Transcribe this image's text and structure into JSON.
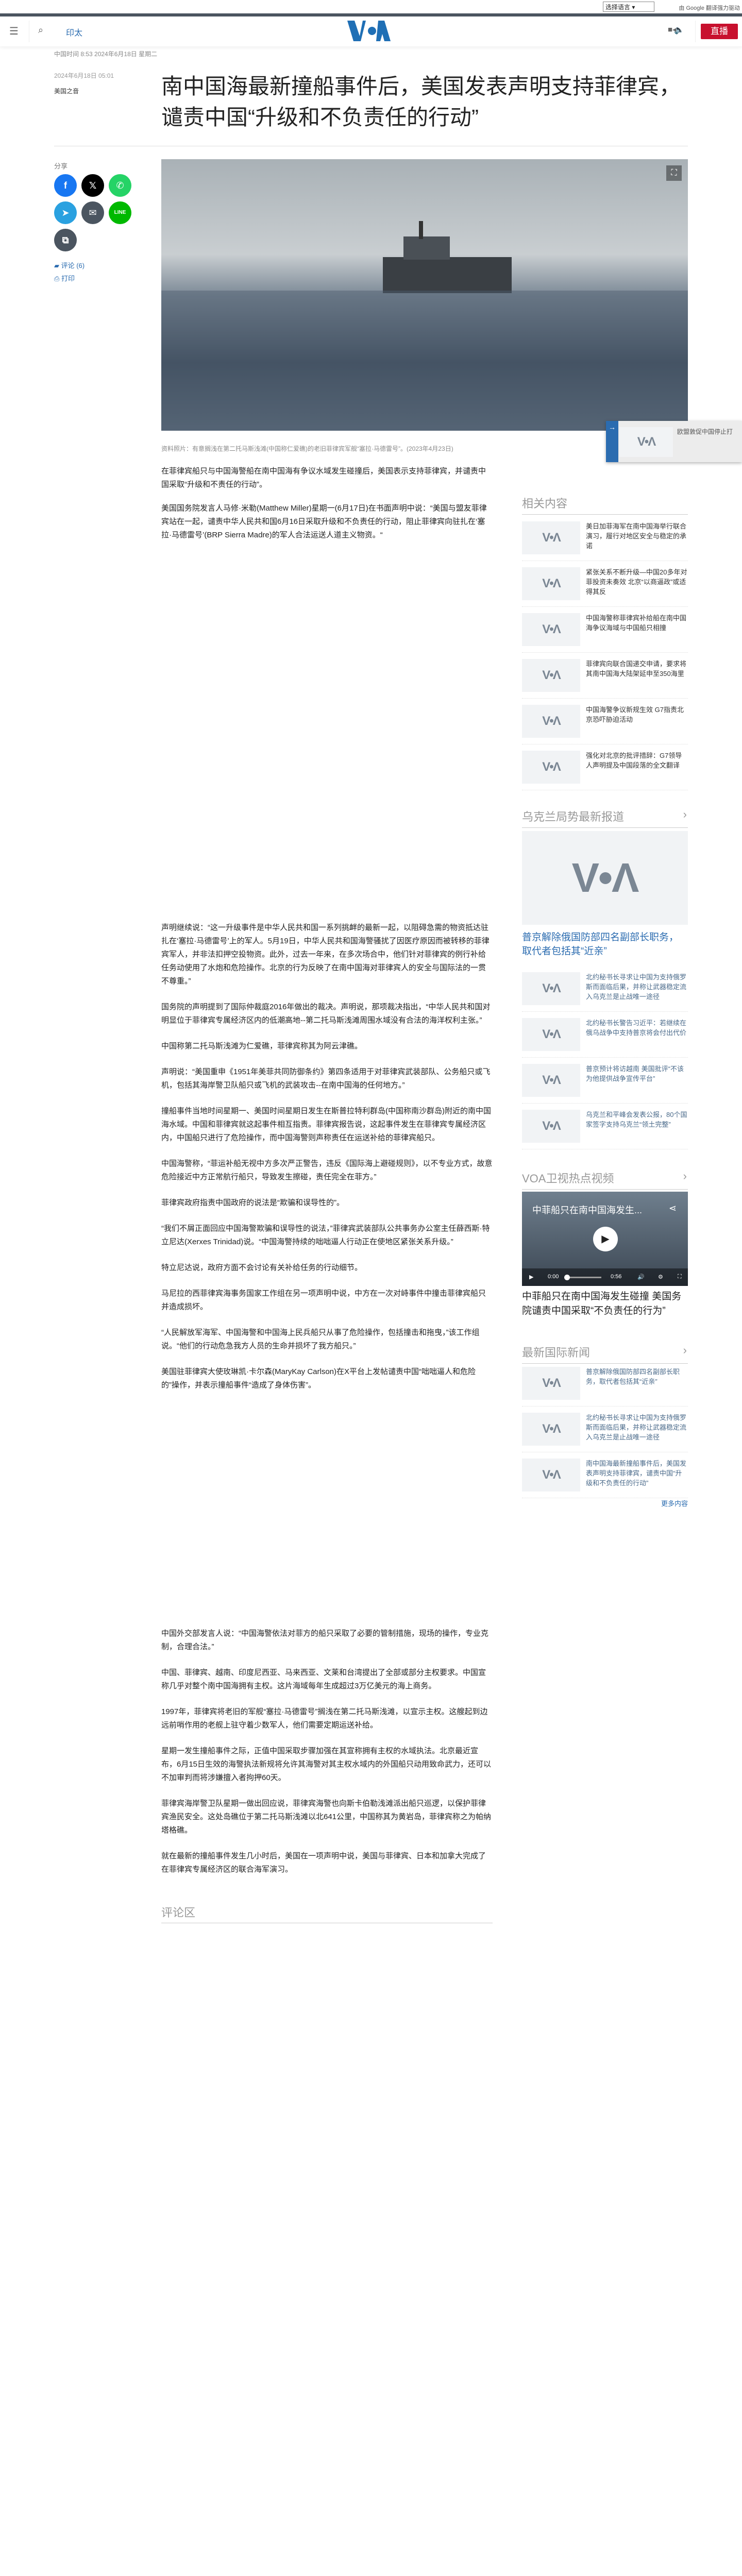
{
  "translate": {
    "select_label": "选择语言",
    "powered": "由 Google 翻译强力驱动"
  },
  "header": {
    "region": "印太",
    "live": "直播",
    "logo": "VOA",
    "menu_icon": "menu-icon",
    "search_icon": "search-icon",
    "audio_icon": "audio-icon",
    "video_icon": "video-icon"
  },
  "clock": "中国时间 8:53 2024年6月18日 星期二",
  "article": {
    "date": "2024年6月18日 05:01",
    "author": "美国之音",
    "title": "南中国海最新撞船事件后，美国发表声明支持菲律宾，谴责中国“升级和不负责任的行动”",
    "caption": "资料照片：有意搁浅在第二托马斯浅滩(中国称仁爱礁)的老旧菲律宾军舰“塞拉·马德雷号”。(2023年4月23日)",
    "share_label": "分享",
    "comments": "评论 (6)",
    "print": "打印",
    "paragraphs_a": [
      "在菲律宾船只与中国海警船在南中国海有争议水域发生碰撞后，美国表示支持菲律宾，并谴责中国采取“升级和不责任的行动”。",
      "美国国务院发言人马修·米勒(Matthew Miller)星期一(6月17日)在书面声明中说：“美国与盟友菲律宾站在一起，谴责中华人民共和国6月16日采取升级和不负责任的行动，阻止菲律宾向驻扎在‘塞拉·马德雷号’(BRP Sierra Madre)的军人合法运送人道主义物资。“"
    ],
    "paragraphs_b": [
      "声明继续说：“这一升级事件是中华人民共和国一系列挑衅的最新一起，以阻碍急需的物资抵达驻扎在‘塞拉·马德雷号’上的军人。5月19日，中华人民共和国海警骚扰了因医疗原因而被转移的菲律宾军人，并非法扣押空投物资。此外，过去一年来，在多次场合中，他们针对菲律宾的例行补给任务动使用了水炮和危险操作。北京的行为反映了在南中国海对菲律宾人的安全与国际法的一贯不尊重。”",
      "国务院的声明提到了国际仲裁庭2016年做出的裁决。声明说，那项裁决指出，“中华人民共和国对明显位于菲律宾专属经济区内的低潮高地--第二托马斯浅滩周围水域没有合法的海洋权利主张。”",
      "中国称第二托马斯浅滩为仁爱礁，菲律宾称其为阿云津礁。",
      "声明说：“美国重申《1951年美菲共同防御条约》第四条适用于对菲律宾武装部队、公务船只或飞机，包括其海岸警卫队船只或飞机的武装攻击--在南中国海的任何地方。”",
      "撞船事件当地时间星期一、美国时间星期日发生在斯普拉特利群岛(中国称南沙群岛)附近的南中国海水域。中国和菲律宾就这起事件相互指责。菲律宾报告说，这起事件发生在菲律宾专属经济区内，中国船只进行了危险操作，而中国海警则声称责任在运送补给的菲律宾船只。",
      "中国海警称，“菲运补船无视中方多次严正警告，违反《国际海上避碰规则》，以不专业方式，故意危险接近中方正常航行船只，导致发生擦碰，责任完全在菲方。”",
      "菲律宾政府指责中国政府的说法是“欺骗和误导性的”。",
      "“我们不屑正面回应中国海警欺骗和误导性的说法，”菲律宾武装部队公共事务办公室主任薛西斯·特立尼达(Xerxes Trinidad)说。“中国海警持续的咄咄逼人行动正在使地区紧张关系升级。”",
      "特立尼达说，政府方面不会讨论有关补给任务的行动细节。",
      "马尼拉的西菲律宾海事务国家工作组在另一项声明中说，中方在一次对峙事件中撞击菲律宾船只并造成损坏。",
      "“人民解放军海军、中国海警和中国海上民兵船只从事了危险操作，包括撞击和拖曳，”该工作组说。“他们的行动危急我方人员的生命并损坏了我方船只。”",
      "美国驻菲律宾大使玫琳凯·卡尔森(MaryKay Carlson)在X平台上发帖谴责中国“咄咄逼人和危险的”操作，并表示撞船事件“造成了身体伤害”。"
    ],
    "paragraphs_c": [
      "中国外交部发言人说：“中国海警依法对菲方的船只采取了必要的管制措施，现场的操作，专业克制，合理合法。”",
      "中国、菲律宾、越南、印度尼西亚、马来西亚、文莱和台湾提出了全部或部分主权要求。中国宣称几乎对整个南中国海拥有主权。这片海域每年生成超过3万亿美元的海上商务。",
      "1997年，菲律宾将老旧的军舰“塞拉·马德雷号”搁浅在第二托马斯浅滩，以宣示主权。这艘起到边远前哨作用的老舰上驻守着少数军人，他们需要定期运送补给。",
      "星期一发生撞船事件之际，正值中国采取步骤加强在其宣称拥有主权的水域执法。北京最近宣布，6月15日生效的海警执法新规将允许其海警对其主权水域内的外国船只动用致命武力，还可以不加审判而将涉嫌擅入者拘押60天。",
      "菲律宾海岸警卫队星期一做出回应说，菲律宾海警也向斯卡伯勒浅滩派出船只巡逻，以保护菲律宾渔民安全。这处岛礁位于第二托马斯浅滩以北641公里，中国称其为黄岩岛，菲律宾称之为帕纳塔格礁。",
      "就在最新的撞船事件发生几小时后，美国在一项声明中说，美国与菲律宾、日本和加拿大完成了在菲律宾专属经济区的联合海军演习。"
    ],
    "comments_section": "评论区"
  },
  "floating": {
    "title": "欧盟敦促中国停止打"
  },
  "sidebar": {
    "related": {
      "title": "相关内容",
      "items": [
        "美日加菲海军在南中国海举行联合演习，履行对地区安全与稳定的承诺",
        "紧张关系不断升级—中国20多年对菲投资未奏效 北京“以商逼政”或适得其反",
        "中国海警称菲律宾补给船在南中国海争议海域与中国船只相撞",
        "菲律宾向联合国递交申请，要求将其南中国海大陆架延申至350海里",
        "中国海警争议新规生效 G7指责北京恐吓胁迫活动",
        "强化对北京的批评措辞：G7领导人声明提及中国段落的全文翻译"
      ]
    },
    "ukraine": {
      "title": "乌克兰局势最新报道",
      "lead": "普京解除俄国防部四名副部长职务，取代者包括其“近亲”",
      "items": [
        "北约秘书长寻求让中国为支持俄罗斯而面临后果，并称让武器稳定流入乌克兰是止战唯一途径",
        "北约秘书长警告习近平：若继续在俄乌战争中支持普京将会付出代价",
        "普京预计将访越南 美国批评“不该为他提供战争宣传平台”",
        "乌克兰和平峰会发表公报，80个国家签字支持乌克兰“领土完整”"
      ]
    },
    "video": {
      "title": "VOA卫视热点视频",
      "overlay_title": "中菲船只在南中国海发生...",
      "time_current": "0:00",
      "time_total": "0:56",
      "progress": 0,
      "caption": "中菲船只在南中国海发生碰撞 美国务院谴责中国采取“不负责任的行为”"
    },
    "intl": {
      "title": "最新国际新闻",
      "items": [
        "普京解除俄国防部四名副部长职务，取代者包括其“近亲”",
        "北约秘书长寻求让中国为支持俄罗斯而面临后果，并称让武器稳定流入乌克兰是止战唯一途径",
        "南中国海最新撞船事件后，美国发表声明支持菲律宾，谴责中国“升级和不负责任的行动”"
      ],
      "more": "更多内容"
    }
  },
  "colors": {
    "brand": "#2b6cb0",
    "live": "#c8102e",
    "facebook": "#1877f2",
    "x": "#000000",
    "whatsapp": "#25d366",
    "telegram": "#2aa1e0",
    "email": "#4b5560",
    "line": "#00b900",
    "copy": "#4b5560"
  }
}
